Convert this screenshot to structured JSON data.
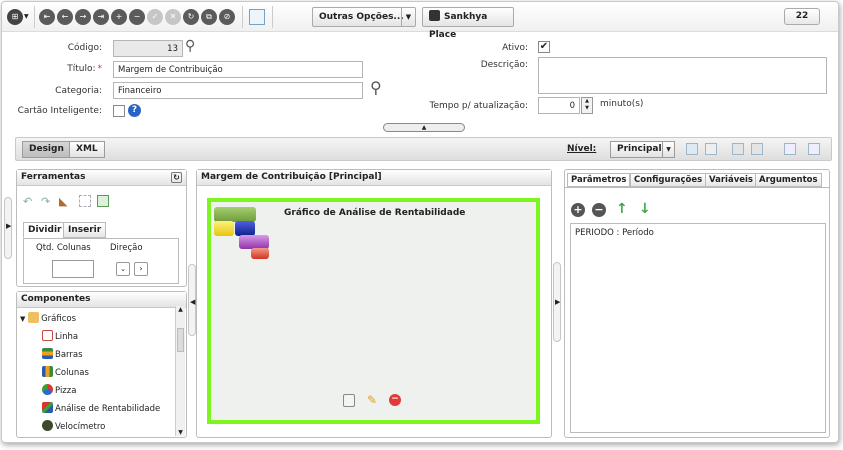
{
  "toolbar": {
    "nav_glyphs": [
      "⇤",
      "←",
      "→",
      "⇥",
      "+",
      "−",
      "✓",
      "✕",
      "↻",
      "⧉",
      "⊘"
    ],
    "outras_opcoes": "Outras Opções...",
    "sankhya_place": "Sankhya Place",
    "badge_count": "22"
  },
  "form": {
    "codigo_label": "Código:",
    "codigo_value": "13",
    "titulo_label": "Título:",
    "titulo_value": "Margem de Contribuição",
    "categoria_label": "Categoria:",
    "categoria_value": "Financeiro",
    "cartao_label": "Cartão Inteligente:",
    "ativo_label": "Ativo:",
    "ativo_checked": "✔",
    "descricao_label": "Descrição:",
    "tempo_label": "Tempo p/ atualização:",
    "tempo_value": "0",
    "tempo_unit": "minuto(s)"
  },
  "design_bar": {
    "design_tab": "Design",
    "xml_tab": "XML",
    "nivel_label": "Nível:",
    "nivel_value": "Principal"
  },
  "ferramentas": {
    "title": "Ferramentas",
    "tab_dividir": "Dividir",
    "tab_inserir": "Inserir",
    "qtd_colunas": "Qtd. Colunas",
    "direcao": "Direção"
  },
  "componentes": {
    "title": "Componentes",
    "root": "Gráficos",
    "items": [
      "Linha",
      "Barras",
      "Colunas",
      "Pizza",
      "Análise de Rentabilidade",
      "Velocímetro"
    ]
  },
  "center": {
    "title": "Margem de Contribuição [Principal]",
    "chart_title": "Gráfico de Análise de Rentabilidade"
  },
  "right": {
    "tabs": [
      "Parâmetros",
      "Configurações",
      "Variáveis",
      "Argumentos"
    ],
    "param_item": "PERIODO : Período"
  },
  "colors": {
    "canvas_border": "#7df51e",
    "blk_green": "#7aa84a",
    "blk_yellow": "#f2d21a",
    "blk_blue": "#1a2ea8",
    "blk_purple": "#9b3fb5",
    "blk_red": "#d9402e"
  }
}
